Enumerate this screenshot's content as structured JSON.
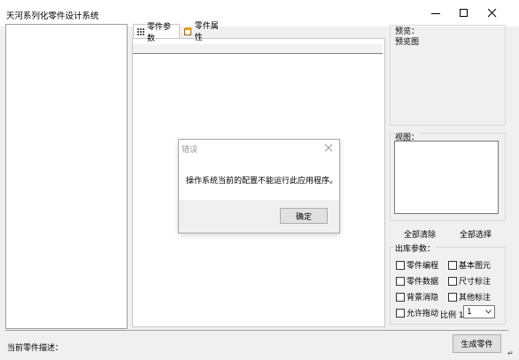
{
  "window": {
    "title": "天河系列化零件设计系统"
  },
  "tabs": [
    {
      "label": "零件参数"
    },
    {
      "label": "零件属性"
    }
  ],
  "preview": {
    "group_label": "预览：",
    "placeholder": "预览图"
  },
  "view": {
    "group_label": "视图："
  },
  "buttons": {
    "clear_all": "全部清除",
    "select_all": "全部选择",
    "generate": "生成零件"
  },
  "export_params": {
    "group_label": "出库参数：",
    "options": [
      {
        "label": "零件编程",
        "checked": false
      },
      {
        "label": "基本图元",
        "checked": false
      },
      {
        "label": "零件数据",
        "checked": false
      },
      {
        "label": "尺寸标注",
        "checked": false
      },
      {
        "label": "背景消隐",
        "checked": false
      },
      {
        "label": "其他标注",
        "checked": false
      },
      {
        "label": "允许拖动",
        "checked": false
      }
    ],
    "scale_label": "比例 1:",
    "scale_value": "1"
  },
  "status": {
    "description_label": "当前零件描述："
  },
  "dialog": {
    "title": "错误",
    "message": "操作系统当前的配置不能运行此应用程序。",
    "ok_label": "确定"
  }
}
